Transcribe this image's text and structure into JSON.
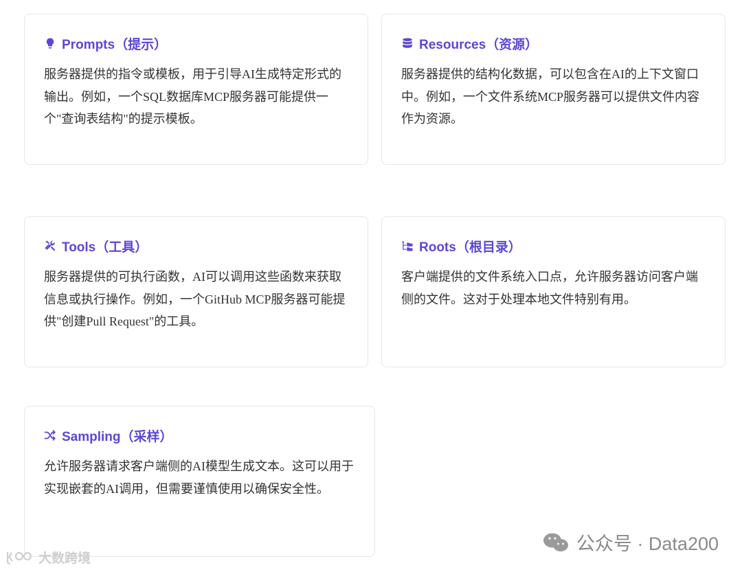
{
  "cards": [
    {
      "id": "prompts",
      "title": "Prompts（提示）",
      "icon": "lightbulb-icon",
      "description": "服务器提供的指令或模板，用于引导AI生成特定形式的输出。例如，一个SQL数据库MCP服务器可能提供一个\"查询表结构\"的提示模板。"
    },
    {
      "id": "resources",
      "title": "Resources（资源）",
      "icon": "database-icon",
      "description": "服务器提供的结构化数据，可以包含在AI的上下文窗口中。例如，一个文件系统MCP服务器可以提供文件内容作为资源。"
    },
    {
      "id": "tools",
      "title": "Tools（工具）",
      "icon": "tools-icon",
      "description": "服务器提供的可执行函数，AI可以调用这些函数来获取信息或执行操作。例如，一个GitHub MCP服务器可能提供\"创建Pull Request\"的工具。"
    },
    {
      "id": "roots",
      "title": "Roots（根目录）",
      "icon": "folder-tree-icon",
      "description": "客户端提供的文件系统入口点，允许服务器访问客户端侧的文件。这对于处理本地文件特别有用。"
    },
    {
      "id": "sampling",
      "title": "Sampling（采样）",
      "icon": "shuffle-icon",
      "description": "允许服务器请求客户端侧的AI模型生成文本。这可以用于实现嵌套的AI调用，但需要谨慎使用以确保安全性。"
    }
  ],
  "watermark": {
    "text": "公众号 · Data200",
    "icon": "wechat-icon"
  },
  "badge": {
    "text": "大数跨境",
    "icon": "brand-logo-icon"
  },
  "colors": {
    "accent": "#5b47d6",
    "text": "#333333",
    "border": "#e6e6ec"
  }
}
